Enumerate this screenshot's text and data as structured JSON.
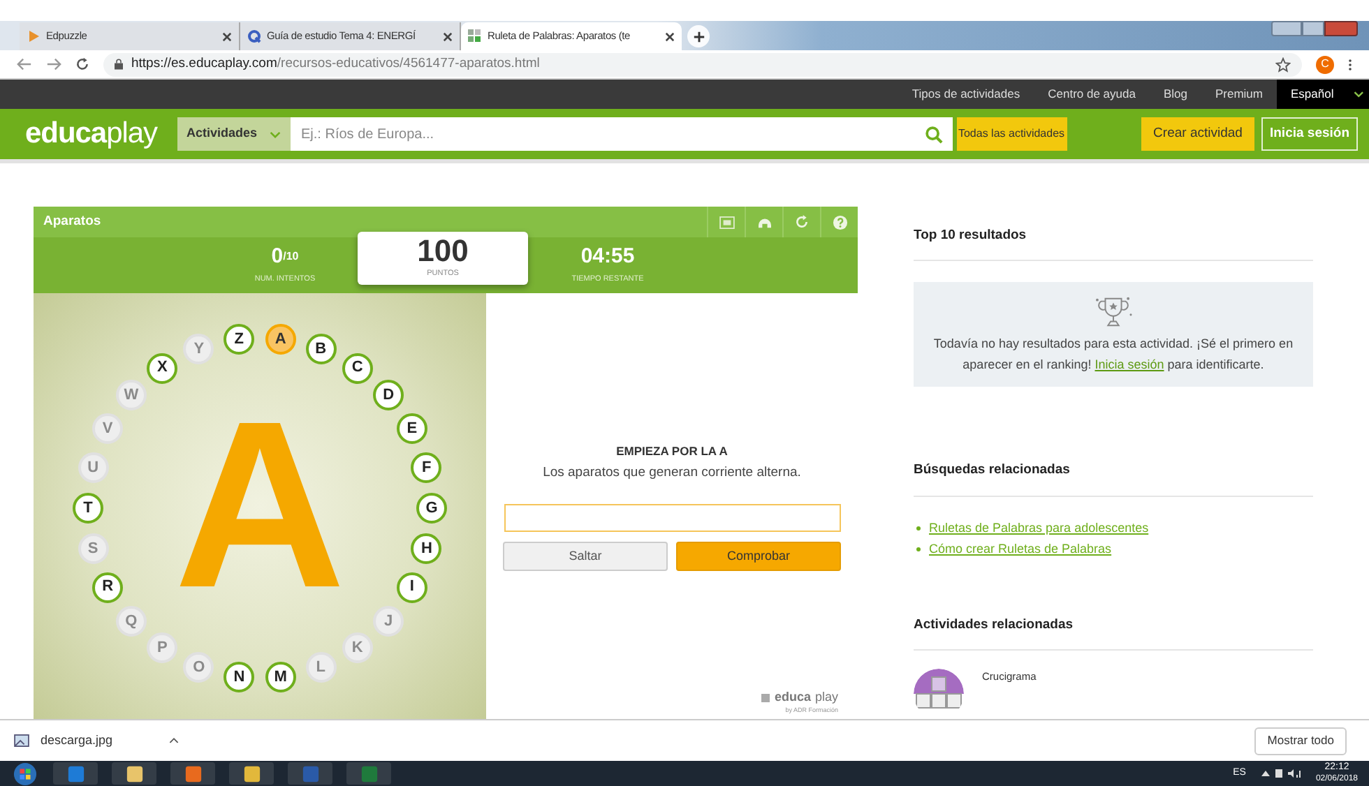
{
  "browser": {
    "tabs": [
      {
        "title": "Edpuzzle",
        "selected": false
      },
      {
        "title": "Guía de estudio Tema 4: ENERGÍ",
        "selected": false
      },
      {
        "title": "Ruleta de Palabras: Aparatos (te",
        "selected": true
      }
    ],
    "url_host": "https://es.educaplay.com",
    "url_path": "/recursos-educativos/4561477-aparatos.html",
    "profile_initial": "C"
  },
  "top_nav": {
    "links": [
      "Tipos de actividades",
      "Centro de ayuda",
      "Blog",
      "Premium"
    ],
    "language": "Español"
  },
  "header": {
    "logo_part1": "educa",
    "logo_part2": "play",
    "category": "Actividades",
    "search_placeholder": "Ej.: Ríos de Europa...",
    "all_activities": "Todas las actividades",
    "create": "Crear actividad",
    "login": "Inicia sesión"
  },
  "game": {
    "title": "Aparatos",
    "attempts": "0",
    "attempts_total": "/10",
    "attempts_label": "NUM. INTENTOS",
    "points": "100",
    "points_label": "PUNTOS",
    "time": "04:55",
    "time_label": "TIEMPO RESTANTE",
    "big_letter": "A",
    "letters": [
      {
        "letter": "A",
        "current": true,
        "faded": false
      },
      {
        "letter": "B",
        "current": false,
        "faded": false
      },
      {
        "letter": "C",
        "current": false,
        "faded": false
      },
      {
        "letter": "D",
        "current": false,
        "faded": false
      },
      {
        "letter": "E",
        "current": false,
        "faded": false
      },
      {
        "letter": "F",
        "current": false,
        "faded": false
      },
      {
        "letter": "G",
        "current": false,
        "faded": false
      },
      {
        "letter": "H",
        "current": false,
        "faded": false
      },
      {
        "letter": "I",
        "current": false,
        "faded": false
      },
      {
        "letter": "J",
        "current": false,
        "faded": true
      },
      {
        "letter": "K",
        "current": false,
        "faded": true
      },
      {
        "letter": "L",
        "current": false,
        "faded": true
      },
      {
        "letter": "M",
        "current": false,
        "faded": false
      },
      {
        "letter": "N",
        "current": false,
        "faded": false
      },
      {
        "letter": "O",
        "current": false,
        "faded": true
      },
      {
        "letter": "P",
        "current": false,
        "faded": true
      },
      {
        "letter": "Q",
        "current": false,
        "faded": true
      },
      {
        "letter": "R",
        "current": false,
        "faded": false
      },
      {
        "letter": "S",
        "current": false,
        "faded": true
      },
      {
        "letter": "T",
        "current": false,
        "faded": false
      },
      {
        "letter": "U",
        "current": false,
        "faded": true
      },
      {
        "letter": "V",
        "current": false,
        "faded": true
      },
      {
        "letter": "W",
        "current": false,
        "faded": true
      },
      {
        "letter": "X",
        "current": false,
        "faded": false
      },
      {
        "letter": "Y",
        "current": false,
        "faded": true
      },
      {
        "letter": "Z",
        "current": false,
        "faded": false
      }
    ],
    "prompt_title": "EMPIEZA POR LA A",
    "prompt": "Los aparatos que generan corriente alterna.",
    "skip": "Saltar",
    "check": "Comprobar",
    "brand_1": "educa",
    "brand_2": "play",
    "brand_by": "by ADR Formación"
  },
  "sidebar": {
    "top_title": "Top 10 resultados",
    "empty_before": "Todavía no hay resultados para esta actividad. ¡Sé el primero en aparecer en el ranking! ",
    "empty_link": "Inicia sesión",
    "empty_after": " para identificarte.",
    "searches_title": "Búsquedas relacionadas",
    "searches": [
      "Ruletas de Palabras para adolescentes",
      "Cómo crear Ruletas de Palabras"
    ],
    "activities_title": "Actividades relacionadas",
    "activities": [
      {
        "type": "Crucigrama"
      }
    ]
  },
  "downloads": {
    "file": "descarga.jpg",
    "show_all": "Mostrar todo"
  },
  "taskbar": {
    "lang": "ES",
    "time": "22:12",
    "date": "02/06/2018"
  }
}
